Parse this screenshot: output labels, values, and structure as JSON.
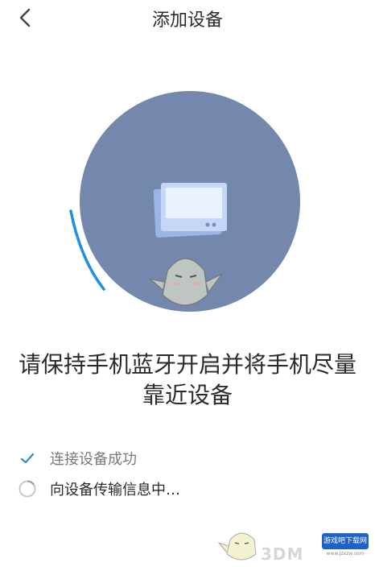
{
  "header": {
    "title": "添加设备"
  },
  "main": {
    "instruction_line1": "请保持手机蓝牙开启并将手机尽量",
    "instruction_line2": "靠近设备"
  },
  "status": [
    {
      "label": "连接设备成功",
      "state": "done",
      "icon": "check-icon"
    },
    {
      "label": "向设备传输信息中…",
      "state": "in-progress",
      "icon": "loading-circle-icon"
    }
  ],
  "watermark": {
    "text_3dm": "3DM",
    "badge_text": "游戏吧下载网",
    "badge_url": "www.jzxzw.com"
  },
  "colors": {
    "circle": "#7488ad",
    "accent": "#1f8fe0",
    "title_text": "#2b2b2b",
    "muted_text": "#7a7a7a"
  }
}
